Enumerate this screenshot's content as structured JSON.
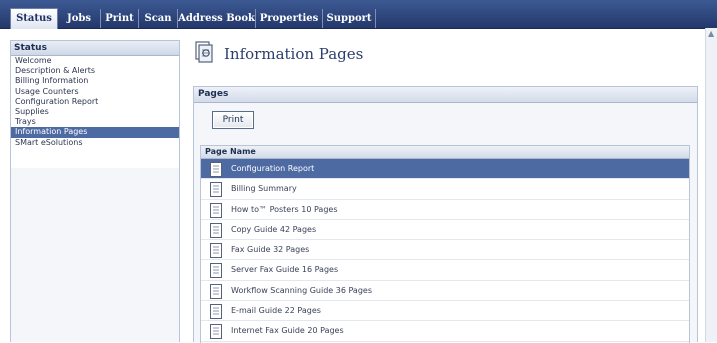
{
  "topnav": {
    "tabs": [
      {
        "label": "Status",
        "active": true
      },
      {
        "label": "Jobs"
      },
      {
        "label": "Print"
      },
      {
        "label": "Scan"
      },
      {
        "label": "Address Book"
      },
      {
        "label": "Properties"
      },
      {
        "label": "Support"
      }
    ]
  },
  "sidebar": {
    "heading": "Status",
    "items": [
      {
        "label": "Welcome"
      },
      {
        "label": "Description & Alerts"
      },
      {
        "label": "Billing Information"
      },
      {
        "label": "Usage Counters"
      },
      {
        "label": "Configuration Report"
      },
      {
        "label": "Supplies"
      },
      {
        "label": "Trays"
      },
      {
        "label": "Information Pages",
        "selected": true
      },
      {
        "label": "SMart eSolutions"
      }
    ]
  },
  "main": {
    "title": "Information Pages",
    "title_icon": "info-pages-icon",
    "panel": {
      "heading": "Pages",
      "print_label": "Print",
      "column_header": "Page Name",
      "rows": [
        {
          "label": "Configuration Report",
          "selected": true
        },
        {
          "label": "Billing Summary"
        },
        {
          "label": "How to™ Posters 10 Pages"
        },
        {
          "label": "Copy Guide 42 Pages"
        },
        {
          "label": "Fax Guide 32 Pages"
        },
        {
          "label": "Server Fax Guide 16 Pages"
        },
        {
          "label": "Workflow Scanning Guide 36 Pages"
        },
        {
          "label": "E-mail Guide 22 Pages"
        },
        {
          "label": "Internet Fax Guide 20 Pages"
        }
      ]
    }
  },
  "colors": {
    "nav_bg": "#2c4479",
    "selected_bg": "#4d6aa3",
    "panel_bg": "#f4f6fa"
  }
}
